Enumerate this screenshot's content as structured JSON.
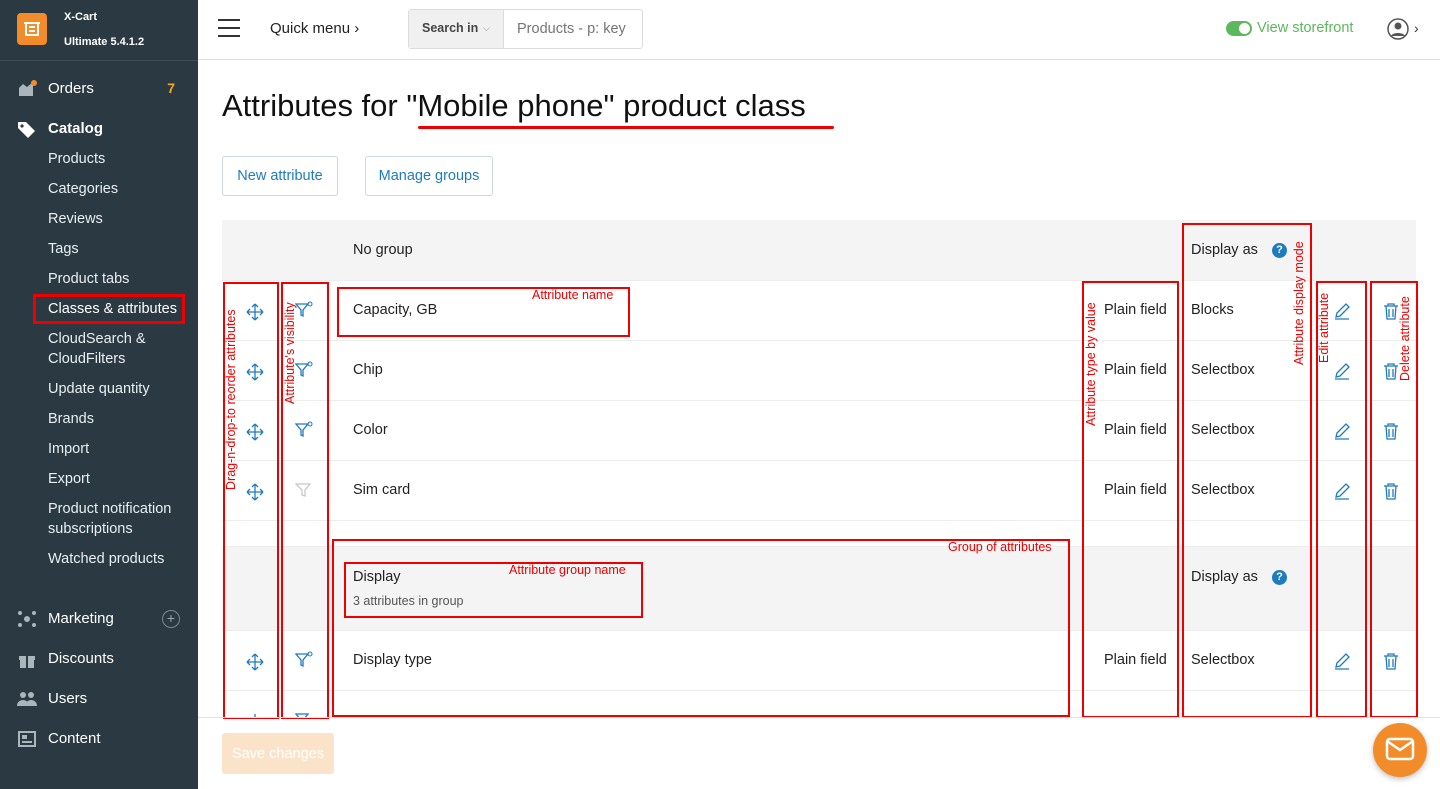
{
  "brand": {
    "name": "X-Cart",
    "version": "Ultimate 5.4.1.2"
  },
  "sidebar": {
    "orders": {
      "label": "Orders",
      "badge": "7"
    },
    "catalog": {
      "label": "Catalog"
    },
    "catalog_items": [
      "Products",
      "Categories",
      "Reviews",
      "Tags",
      "Product tabs",
      "Classes & attributes",
      "CloudSearch &",
      "CloudFilters",
      "Update quantity",
      "Brands",
      "Import",
      "Export",
      "Product notification",
      "subscriptions",
      "Watched products"
    ],
    "marketing": {
      "label": "Marketing"
    },
    "discounts": {
      "label": "Discounts"
    },
    "users": {
      "label": "Users"
    },
    "content": {
      "label": "Content"
    }
  },
  "header": {
    "quick_menu": "Quick menu",
    "search_in": "Search in",
    "search_placeholder": "Products - p: key",
    "storefront": "View storefront"
  },
  "page": {
    "title": "Attributes for \"Mobile phone\" product class",
    "new_attribute": "New attribute",
    "manage_groups": "Manage groups",
    "save": "Save changes"
  },
  "table": {
    "group_header": {
      "name": "No group",
      "display_as": "Display as"
    },
    "rows": [
      {
        "name": "Capacity, GB",
        "type": "Plain field",
        "display": "Blocks"
      },
      {
        "name": "Chip",
        "type": "Plain field",
        "display": "Selectbox"
      },
      {
        "name": "Color",
        "type": "Plain field",
        "display": "Selectbox"
      },
      {
        "name": "Sim card",
        "type": "Plain field",
        "display": "Selectbox"
      }
    ],
    "group2": {
      "name": "Display",
      "count": "3 attributes in group",
      "display_as": "Display as"
    },
    "rows2": [
      {
        "name": "Display type",
        "type": "Plain field",
        "display": "Selectbox"
      }
    ]
  },
  "annotations": {
    "attribute_name": "Attribute name",
    "group_of_attributes": "Group of attributes",
    "attribute_group_name": "Attribute group name",
    "drag_reorder": "Drag-n-drop-to reorder attributes",
    "visibility": "Attribute's visibility",
    "type_by_value": "Attribute type by value",
    "display_mode": "Attribute display mode",
    "edit_attribute": "Edit attribute",
    "delete_attribute": "Delete attribute"
  },
  "colors": {
    "sidebar_bg": "#2b3a42",
    "link": "#1f7bbf",
    "accent": "#f28c2b",
    "annotation": "#e00000",
    "storefront": "#5cb85c"
  }
}
